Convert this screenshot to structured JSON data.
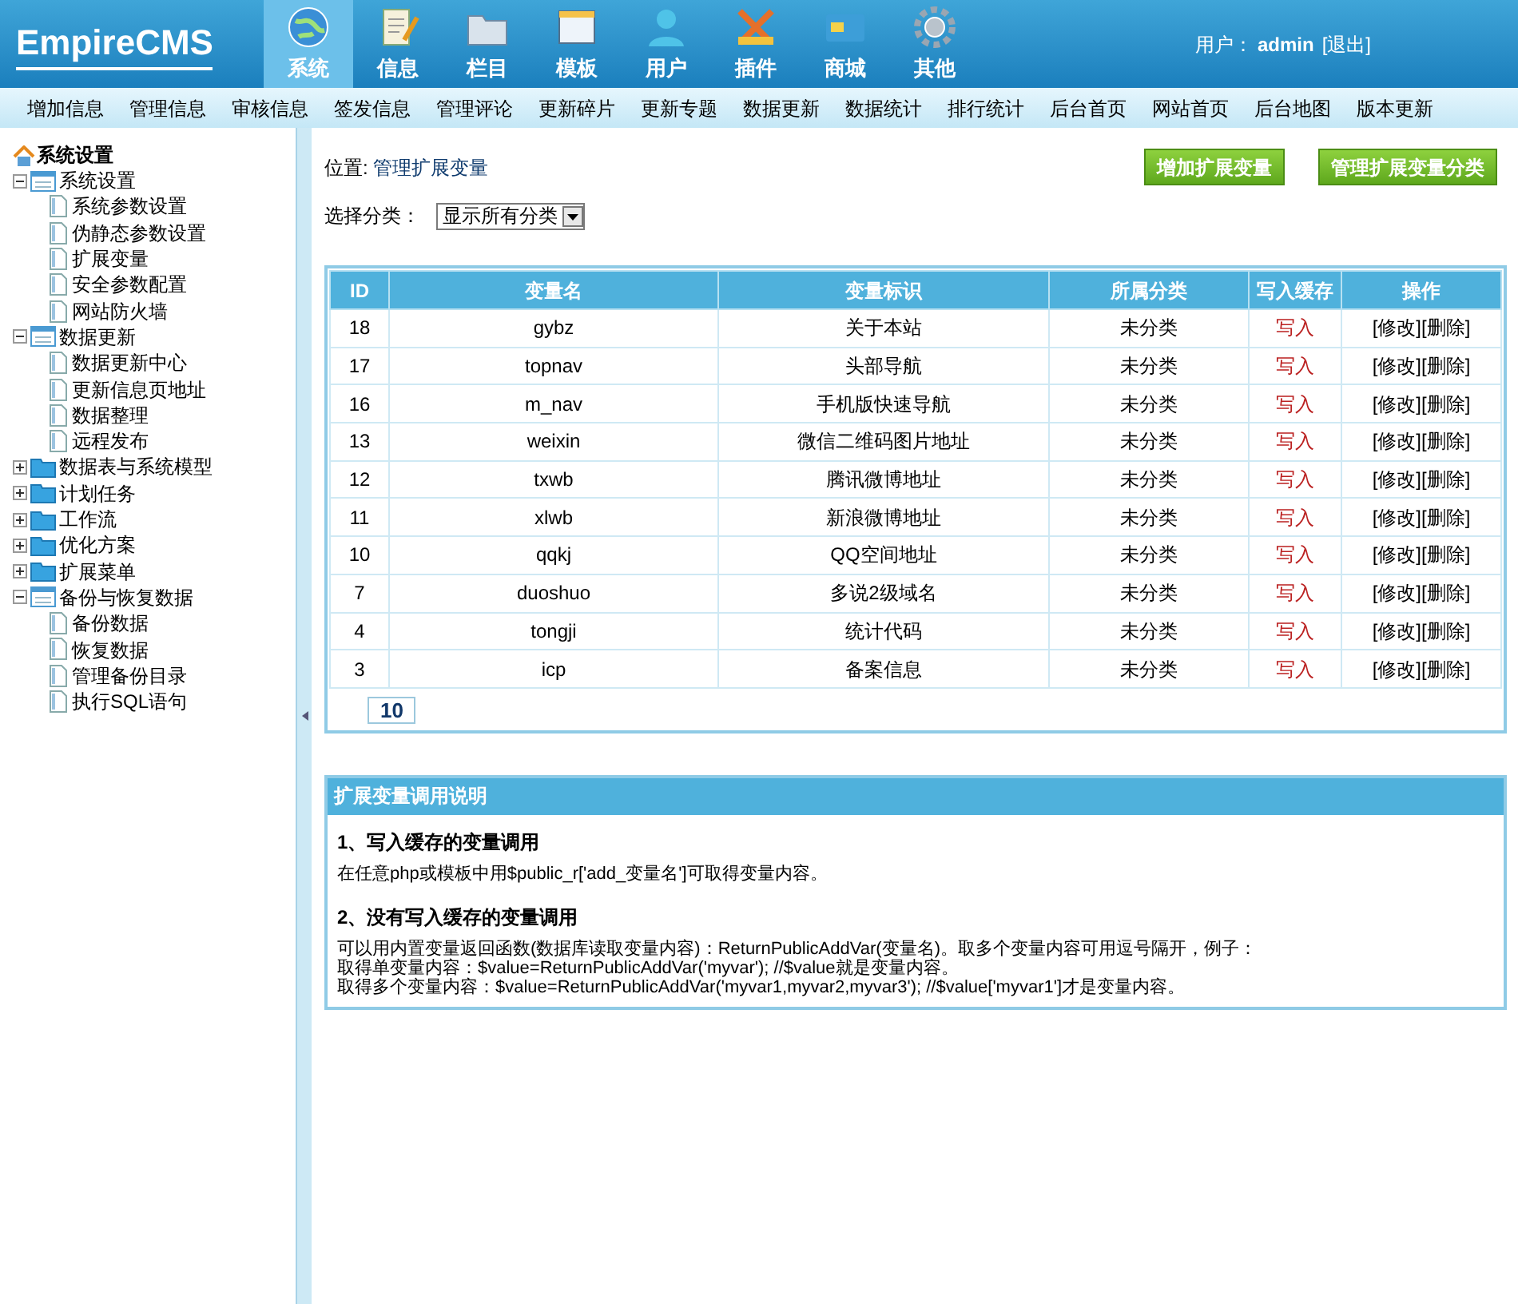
{
  "header": {
    "logo": "EmpireCMS",
    "nav": [
      {
        "label": "系统",
        "selected": true
      },
      {
        "label": "信息",
        "selected": false
      },
      {
        "label": "栏目",
        "selected": false
      },
      {
        "label": "模板",
        "selected": false
      },
      {
        "label": "用户",
        "selected": false
      },
      {
        "label": "插件",
        "selected": false
      },
      {
        "label": "商城",
        "selected": false
      },
      {
        "label": "其他",
        "selected": false
      }
    ],
    "user_label": "用户：",
    "user": "admin",
    "logout": "[退出]"
  },
  "menu": [
    "增加信息",
    "管理信息",
    "审核信息",
    "签发信息",
    "管理评论",
    "更新碎片",
    "更新专题",
    "数据更新",
    "数据统计",
    "排行统计",
    "后台首页",
    "网站首页",
    "后台地图",
    "版本更新"
  ],
  "sidebar": {
    "title": "系统设置",
    "groups": [
      {
        "label": "系统设置",
        "expanded": true,
        "children": [
          {
            "label": "系统参数设置"
          },
          {
            "label": "伪静态参数设置"
          },
          {
            "label": "扩展变量"
          },
          {
            "label": "安全参数配置"
          },
          {
            "label": "网站防火墙"
          }
        ]
      },
      {
        "label": "数据更新",
        "expanded": true,
        "children": [
          {
            "label": "数据更新中心"
          },
          {
            "label": "更新信息页地址"
          },
          {
            "label": "数据整理"
          },
          {
            "label": "远程发布"
          }
        ]
      },
      {
        "label": "数据表与系统模型",
        "expanded": false
      },
      {
        "label": "计划任务",
        "expanded": false
      },
      {
        "label": "工作流",
        "expanded": false
      },
      {
        "label": "优化方案",
        "expanded": false
      },
      {
        "label": "扩展菜单",
        "expanded": false
      },
      {
        "label": "备份与恢复数据",
        "expanded": true,
        "children": [
          {
            "label": "备份数据"
          },
          {
            "label": "恢复数据"
          },
          {
            "label": "管理备份目录"
          },
          {
            "label": "执行SQL语句"
          }
        ]
      }
    ]
  },
  "location": {
    "label": "位置:",
    "link": "管理扩展变量"
  },
  "buttons": [
    "增加扩展变量",
    "管理扩展变量分类"
  ],
  "filter": {
    "label": "选择分类：",
    "value": "显示所有分类"
  },
  "table": {
    "columns": [
      "ID",
      "变量名",
      "变量标识",
      "所属分类",
      "写入缓存",
      "操作"
    ],
    "rows": [
      {
        "id": "18",
        "name": "gybz",
        "title": "关于本站",
        "category": "未分类",
        "cache": "写入",
        "edit": "[修改]",
        "delete": "[删除]"
      },
      {
        "id": "17",
        "name": "topnav",
        "title": "头部导航",
        "category": "未分类",
        "cache": "写入",
        "edit": "[修改]",
        "delete": "[删除]"
      },
      {
        "id": "16",
        "name": "m_nav",
        "title": "手机版快速导航",
        "category": "未分类",
        "cache": "写入",
        "edit": "[修改]",
        "delete": "[删除]"
      },
      {
        "id": "13",
        "name": "weixin",
        "title": "微信二维码图片地址",
        "category": "未分类",
        "cache": "写入",
        "edit": "[修改]",
        "delete": "[删除]"
      },
      {
        "id": "12",
        "name": "txwb",
        "title": "腾讯微博地址",
        "category": "未分类",
        "cache": "写入",
        "edit": "[修改]",
        "delete": "[删除]"
      },
      {
        "id": "11",
        "name": "xlwb",
        "title": "新浪微博地址",
        "category": "未分类",
        "cache": "写入",
        "edit": "[修改]",
        "delete": "[删除]"
      },
      {
        "id": "10",
        "name": "qqkj",
        "title": "QQ空间地址",
        "category": "未分类",
        "cache": "写入",
        "edit": "[修改]",
        "delete": "[删除]"
      },
      {
        "id": "7",
        "name": "duoshuo",
        "title": "多说2级域名",
        "category": "未分类",
        "cache": "写入",
        "edit": "[修改]",
        "delete": "[删除]"
      },
      {
        "id": "4",
        "name": "tongji",
        "title": "统计代码",
        "category": "未分类",
        "cache": "写入",
        "edit": "[修改]",
        "delete": "[删除]"
      },
      {
        "id": "3",
        "name": "icp",
        "title": "备案信息",
        "category": "未分类",
        "cache": "写入",
        "edit": "[修改]",
        "delete": "[删除]"
      }
    ],
    "page": "10"
  },
  "help": {
    "title": "扩展变量调用说明",
    "sections": [
      {
        "heading": "1、写入缓存的变量调用",
        "lines": [
          "在任意php或模板中用$public_r['add_变量名']可取得变量内容。"
        ]
      },
      {
        "heading": "2、没有写入缓存的变量调用",
        "lines": [
          "可以用内置变量返回函数(数据库读取变量内容)：ReturnPublicAddVar(变量名)。取多个变量内容可用逗号隔开，例子：",
          "取得单变量内容：$value=ReturnPublicAddVar('myvar'); //$value就是变量内容。",
          "取得多个变量内容：$value=ReturnPublicAddVar('myvar1,myvar2,myvar3'); //$value['myvar1']才是变量内容。"
        ]
      }
    ]
  }
}
